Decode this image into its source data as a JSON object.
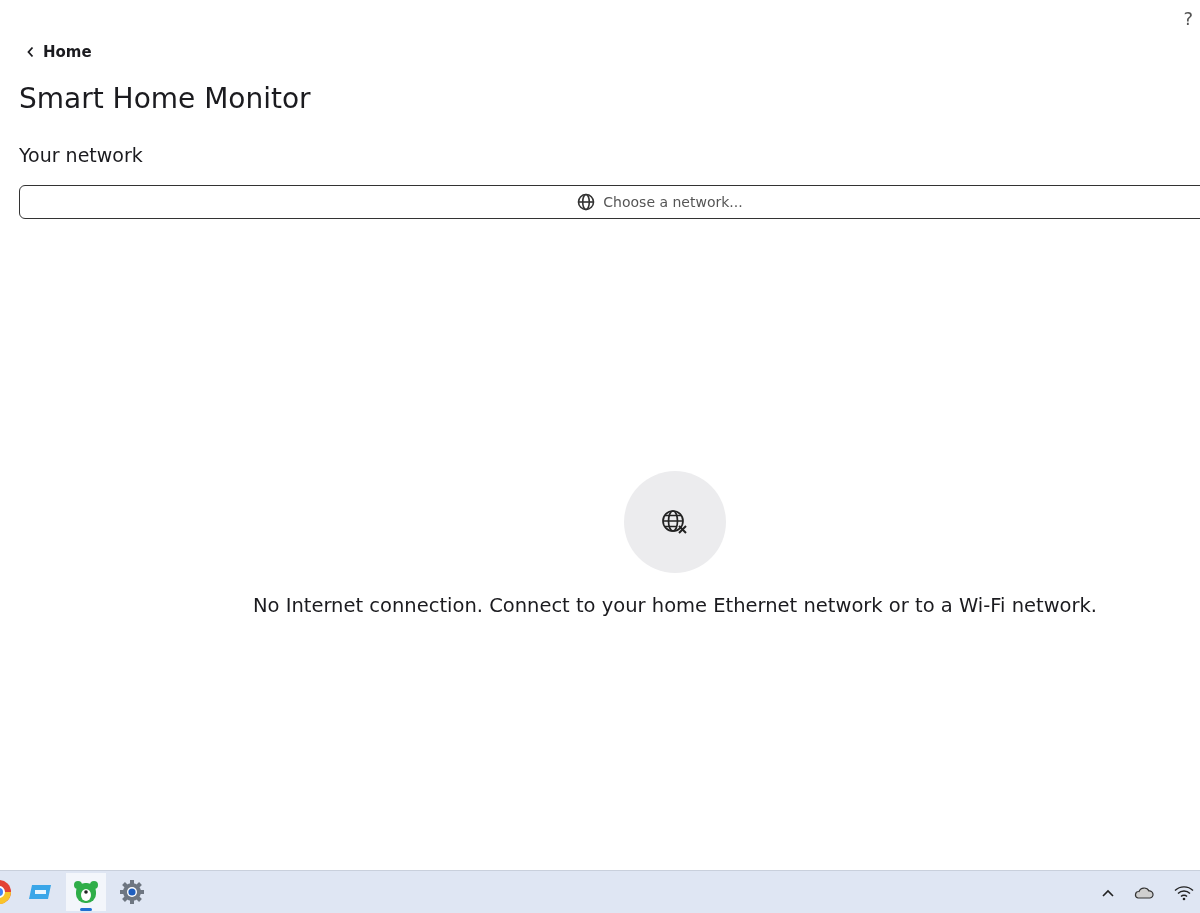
{
  "help": "?",
  "back": {
    "label": "Home"
  },
  "title": "Smart Home Monitor",
  "section": "Your network",
  "network_button": {
    "label": "Choose a network..."
  },
  "empty_state": {
    "message": "No Internet connection. Connect to your home Ethernet network or to a Wi-Fi network."
  },
  "taskbar": {
    "apps": [
      {
        "kind": "browser",
        "selected": false
      },
      {
        "kind": "window",
        "selected": false
      },
      {
        "kind": "bear",
        "selected": true
      },
      {
        "kind": "settings",
        "selected": false
      }
    ]
  }
}
